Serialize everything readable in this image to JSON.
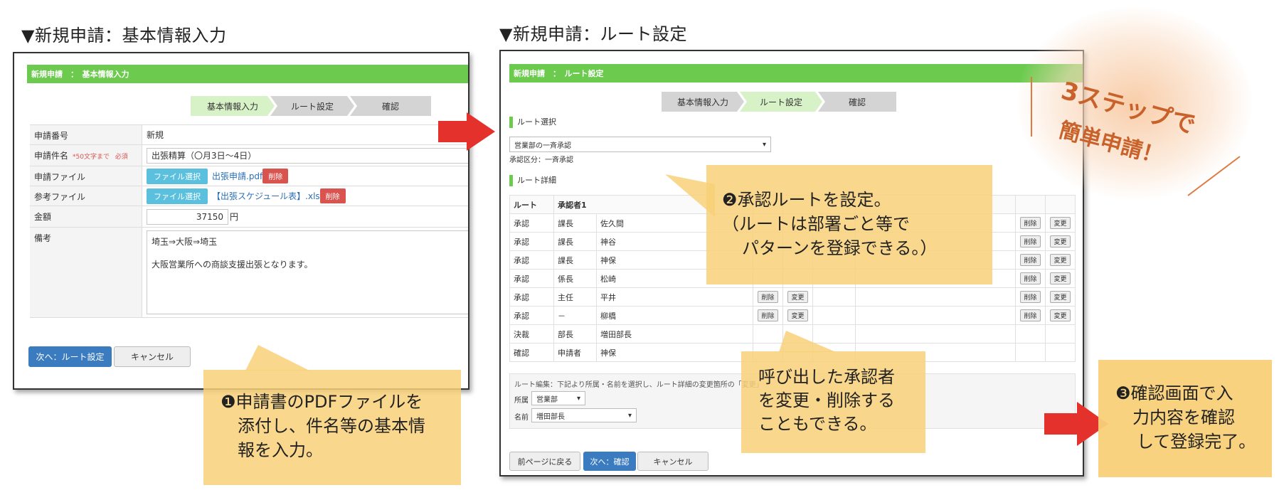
{
  "left": {
    "title": "▼新規申請：基本情報入力",
    "header": "新規申請　：　基本情報入力",
    "steps": [
      "基本情報入力",
      "ルート設定",
      "確認"
    ],
    "form": {
      "no_label": "申請番号",
      "no_value": "新規",
      "subject_label": "申請件名",
      "subject_hint": "*50文字まで",
      "subject_required": "必須",
      "subject_value": "出張精算（〇月3日〜4日）",
      "file_label": "申請ファイル",
      "file_btn": "ファイル選択",
      "file_link": "出張申請.pdf",
      "file_del": "削除",
      "ref_label": "参考ファイル",
      "ref_btn": "ファイル選択",
      "ref_link": "【出張スケジュール表】.xls",
      "ref_del": "削除",
      "amount_label": "金額",
      "amount_value": "37150",
      "amount_unit": "円",
      "memo_label": "備考",
      "memo_line1": "埼玉⇒大阪⇒埼玉",
      "memo_line2": "大阪営業所への商談支援出張となります。"
    },
    "next_btn": "次へ：ルート設定",
    "cancel_btn": "キャンセル"
  },
  "right": {
    "title": "▼新規申請：ルート設定",
    "header": "新規申請　：　ルート設定",
    "steps": [
      "基本情報入力",
      "ルート設定",
      "確認"
    ],
    "route_select_heading": "ルート選択",
    "route_select_value": "営業部の一斉承認",
    "approval_type": "承認区分：一斉承認",
    "route_detail_heading": "ルート詳細",
    "col_route": "ルート",
    "col_approver": "承認者1",
    "rows": [
      {
        "type": "承認",
        "role": "課長",
        "name": "佐久間"
      },
      {
        "type": "承認",
        "role": "課長",
        "name": "神谷"
      },
      {
        "type": "承認",
        "role": "課長",
        "name": "神保"
      },
      {
        "type": "承認",
        "role": "係長",
        "name": "松崎"
      },
      {
        "type": "承認",
        "role": "主任",
        "name": "平井"
      },
      {
        "type": "承認",
        "role": "－",
        "name": "柳橋"
      },
      {
        "type": "決裁",
        "role": "部長",
        "name": "増田部長"
      },
      {
        "type": "確認",
        "role": "申請者",
        "name": "神保"
      }
    ],
    "del": "削除",
    "change": "変更",
    "edit_note": "ルート編集：下記より所属・名前を選択し、ルート詳細の変更箇所の「変更」",
    "dept_label": "所属",
    "dept_value": "営業部",
    "name_label": "名前",
    "name_value": "増田部長",
    "back_btn": "前ページに戻る",
    "next_btn": "次へ：確認",
    "cancel_btn": "キャンセル"
  },
  "notes": {
    "note1_num": "❶",
    "note1": [
      "申請書のPDFファイルを",
      "添付し、件名等の基本情",
      "報を入力。"
    ],
    "note2_num": "❷",
    "note2": [
      "承認ルートを設定。",
      "（ルートは部署ごと等で",
      "パターンを登録できる。）"
    ],
    "note3": [
      "呼び出した承認者",
      "を変更・削除する",
      "こともできる。"
    ],
    "note4_num": "❸",
    "note4": [
      "確認画面で入",
      "力内容を確認",
      "して登録完了。"
    ],
    "badge_line1": "3ステップで",
    "badge_line2": "簡単申請！"
  },
  "colors": {
    "green": "#6ccb4f",
    "red": "#e5312b",
    "note": "#f8d078",
    "badge_text": "#c8622a"
  }
}
